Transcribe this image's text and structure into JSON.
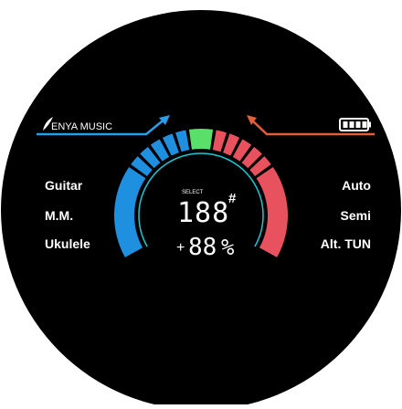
{
  "brand": {
    "name": "ENYA MUSIC"
  },
  "status": {
    "battery_level": 1.0,
    "battery_icon": "battery-full-icon"
  },
  "instruments": [
    {
      "label": "Guitar"
    },
    {
      "label": "M.M."
    },
    {
      "label": "Ukulele"
    }
  ],
  "modes": [
    {
      "label": "Auto"
    },
    {
      "label": "Semi"
    },
    {
      "label": "Alt. TUN"
    }
  ],
  "display": {
    "select_label": "SELECT",
    "note_digits": "188",
    "accidental": "#",
    "cents_sign": "+",
    "cents_digits": "88",
    "cents_unit": "%"
  },
  "colors": {
    "flat": "#1f8fe0",
    "in_tune": "#5ae06a",
    "sharp": "#e8525e",
    "ring": "#1ec8d4",
    "arrow_left": "#2a9de8",
    "arrow_right": "#e0603a"
  },
  "meter": {
    "segments_per_side": 5,
    "active_segment": "center"
  }
}
